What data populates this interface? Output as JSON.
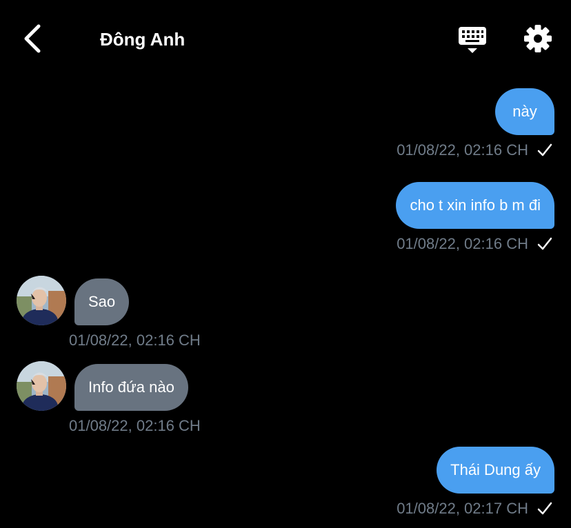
{
  "header": {
    "title": "Đông Anh",
    "back_icon": "chevron-left-icon",
    "keyboard_icon": "keyboard-icon",
    "settings_icon": "gear-icon"
  },
  "colors": {
    "background": "#000000",
    "outgoing_bubble": "#4a9ff0",
    "incoming_bubble": "#687380",
    "timestamp": "#707c89"
  },
  "messages": [
    {
      "direction": "outgoing",
      "text": "này",
      "time": "01/08/22, 02:16 CH",
      "status": "check-icon"
    },
    {
      "direction": "outgoing",
      "text": "cho t xin info b m đi",
      "time": "01/08/22, 02:16 CH",
      "status": "check-icon"
    },
    {
      "direction": "incoming",
      "text": "Sao",
      "time": "01/08/22, 02:16 CH"
    },
    {
      "direction": "incoming",
      "text": "Info đứa nào",
      "time": "01/08/22, 02:16 CH"
    },
    {
      "direction": "outgoing",
      "text": "Thái Dung ấy",
      "time": "01/08/22, 02:17 CH",
      "status": "check-icon"
    }
  ]
}
